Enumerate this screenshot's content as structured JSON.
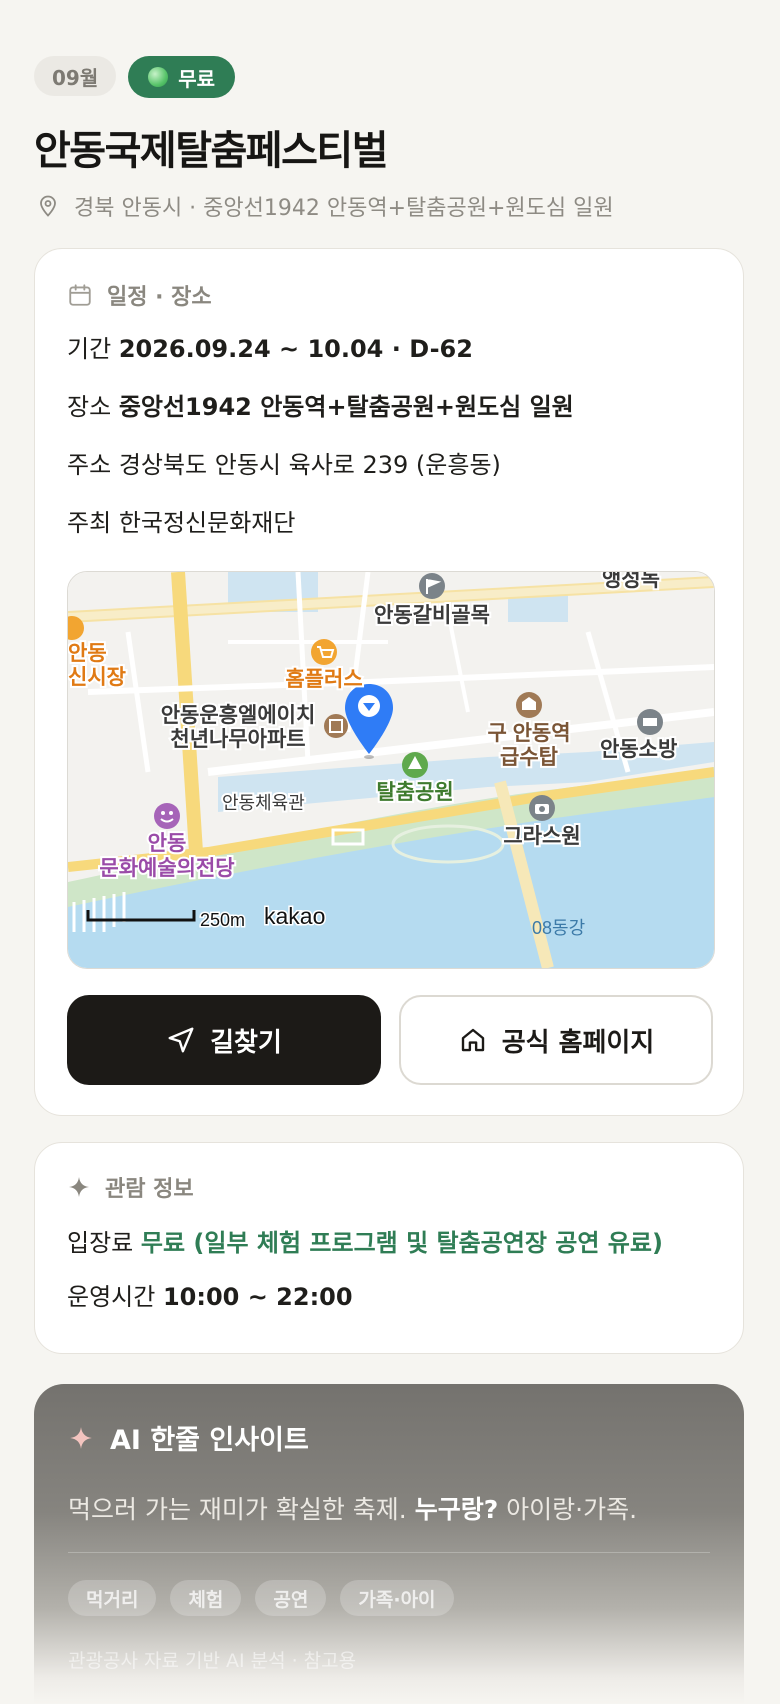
{
  "header": {
    "month_badge": "09월",
    "fee_badge": "무료",
    "title": "안동국제탈춤페스티벌",
    "location": "경북 안동시 · 중앙선1942 안동역+탈춤공원+원도심 일원"
  },
  "schedule": {
    "heading": "일정 · 장소",
    "rows": [
      {
        "label": "기간",
        "value": "2026.09.24 ~ 10.04 · D-62"
      },
      {
        "label": "장소",
        "value": "중앙선1942 안동역+탈춤공원+원도심 일원"
      },
      {
        "label": "주소",
        "value": "경상북도 안동시 육사로 239 (운흥동)"
      },
      {
        "label": "주최",
        "value": "한국정신문화재단"
      }
    ],
    "map": {
      "labels": {
        "galbi": "안동갈비골목",
        "homeplus": "홈플러스",
        "apt_line1": "안동운흥엘에이치",
        "apt_line2": "천년나무아파트",
        "station_line1": "구 안동역",
        "station_line2": "급수탑",
        "fire": "안동소방",
        "park": "탈춤공원",
        "gym": "안동체육관",
        "arts_line1": "안동",
        "arts_line2": "문화예술의전당",
        "graswon": "그라스원",
        "market_line1": "안동",
        "market_line2": "신시장",
        "top_right": "앵성녹",
        "river": "08동강",
        "scale": "250m",
        "brand": "kakao"
      }
    },
    "buttons": {
      "directions": "길찾기",
      "homepage": "공식 홈페이지"
    }
  },
  "viewing": {
    "heading": "관람 정보",
    "fee_label": "입장료",
    "fee_value": "무료 (일부 체험 프로그램 및 탈춤공연장 공연 유료)",
    "hours_label": "운영시간",
    "hours_value": "10:00 ~ 22:00"
  },
  "ai": {
    "heading": "AI 한줄 인사이트",
    "text_a": "먹으러 가는 재미가 확실한 축제.",
    "text_b": "누구랑?",
    "text_c": "아이랑·가족.",
    "tags": [
      "먹거리",
      "체험",
      "공연",
      "가족·아이"
    ],
    "note": "관광공사 자료 기반 AI 분석 · 참고용"
  },
  "colors": {
    "accent_green": "#2f7d55",
    "dark_button": "#1c1a17",
    "marker_blue": "#2f7cf6"
  }
}
